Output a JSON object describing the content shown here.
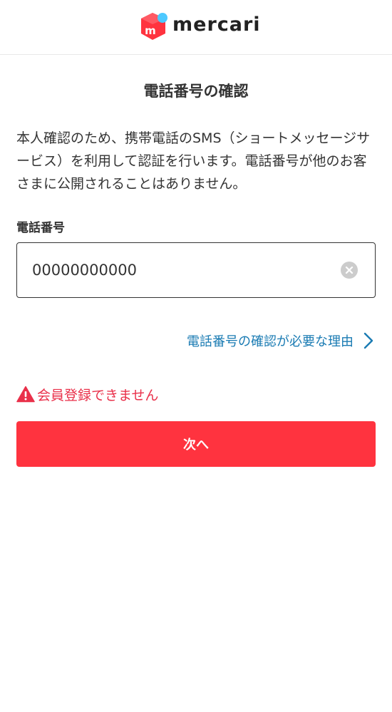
{
  "header": {
    "logo_text": "mercari",
    "logo_mark_letter": "m",
    "brand_color": "#ff333f",
    "accent_dot_color": "#4dc9ff"
  },
  "main": {
    "title": "電話番号の確認",
    "description": "本人確認のため、携帯電話のSMS（ショートメッセージサービス）を利用して認証を行います。電話番号が他のお客さまに公開されることはありません。",
    "phone_label": "電話番号",
    "phone_value": "00000000000",
    "clear_icon": "clear-circle-icon",
    "reason_link": "電話番号の確認が必要な理由",
    "reason_link_icon": "chevron-right-icon",
    "error_icon": "warning-icon",
    "error_message": "会員登録できません",
    "next_button": "次へ"
  },
  "colors": {
    "link": "#1a7bb3",
    "error": "#e9304a",
    "button": "#ff333f",
    "text": "#333333"
  }
}
